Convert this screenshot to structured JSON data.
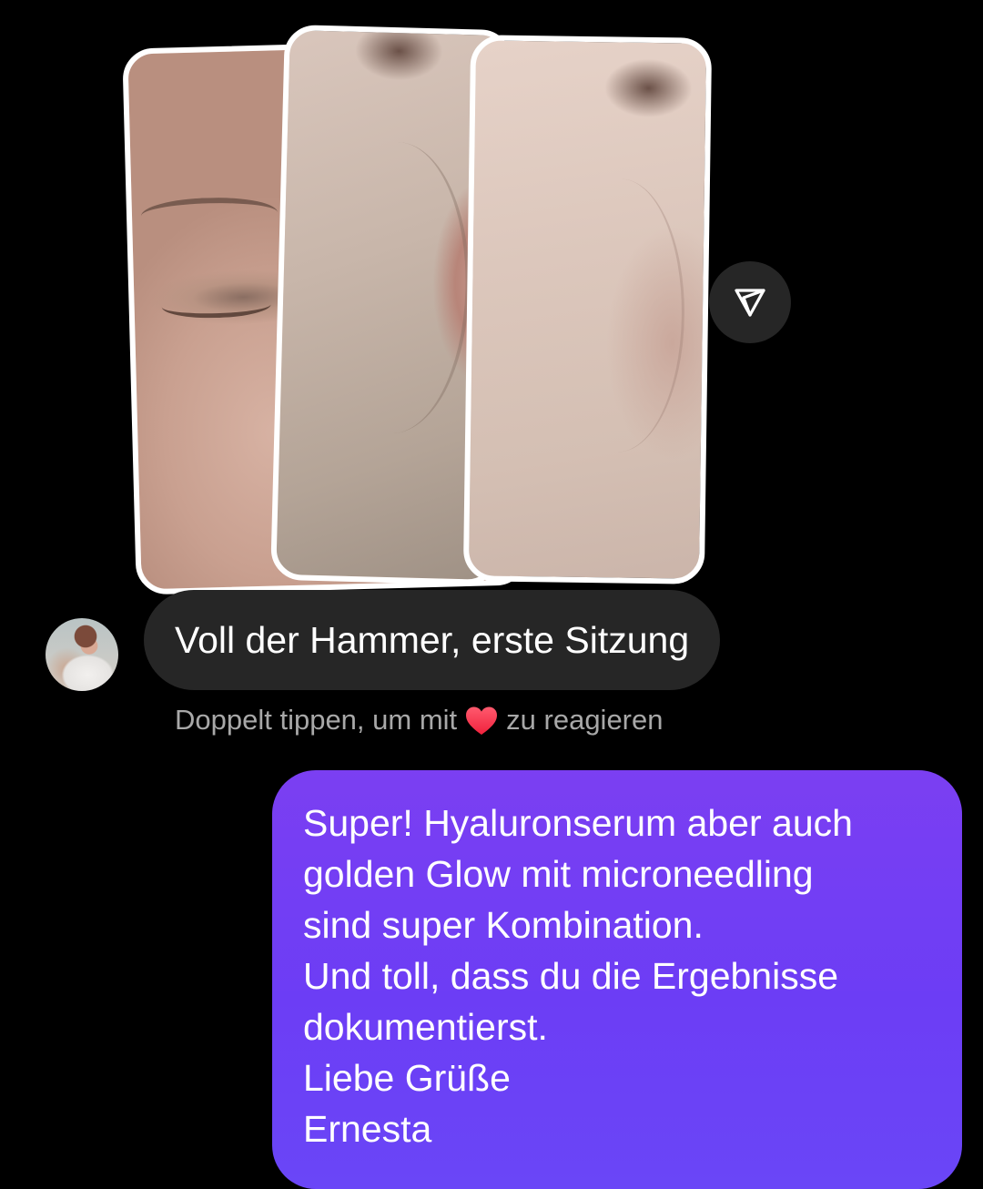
{
  "conversation": {
    "incoming_message": {
      "text": "Voll der Hammer, erste Sitzung",
      "reaction_hint_before": "Doppelt tippen, um mit",
      "reaction_hint_after": "zu reagieren",
      "reaction_icon": "heart-icon"
    },
    "outgoing_message": {
      "lines": [
        "Super! Hyaluronserum aber auch",
        "golden Glow mit microneedling",
        "sind super Kombination.",
        "Und toll, dass du die Ergebnisse",
        "dokumentierst.",
        "Liebe Grüße",
        "Ernesta"
      ]
    },
    "share_icon": "share-send-icon"
  },
  "colors": {
    "background": "#000000",
    "incoming_bubble": "#262626",
    "outgoing_bubble": "#6c3df5",
    "hint_text": "#a8a8a8",
    "heart": "#ff3040"
  }
}
